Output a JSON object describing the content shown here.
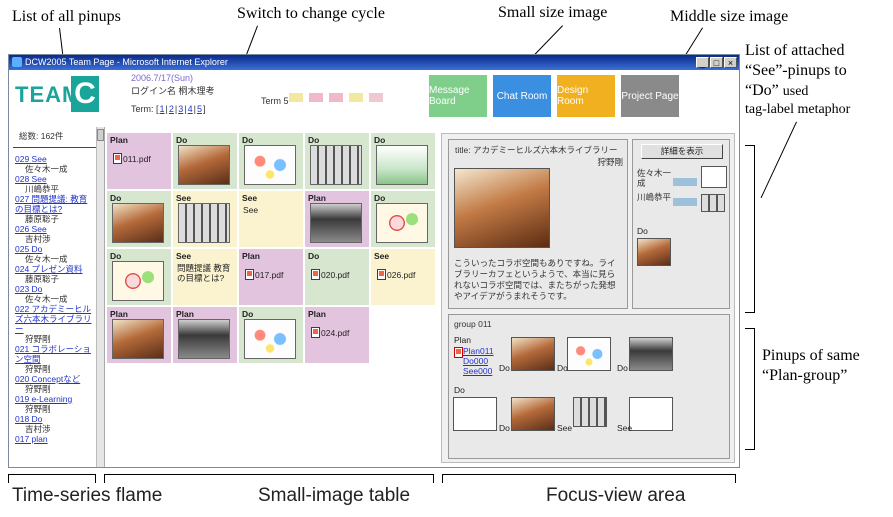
{
  "annotations": {
    "list_of_pinups": "List of all pinups",
    "switch_cycle": "Switch to change cycle",
    "small_image": "Small size image",
    "middle_image": "Middle size image",
    "attached_line1": "List of attached",
    "attached_line2": "“See”-pinups to",
    "attached_line3": "“Do”",
    "attached_line3b": "used",
    "attached_line4": "tag-label metaphor",
    "pinups_line1": "Pinups of same",
    "pinups_line2": "“Plan-group”",
    "time_series": "Time-series flame",
    "small_table": "Small-image table",
    "focus_view": "Focus-view area"
  },
  "window": {
    "title": "DCW2005 Team Page - Microsoft Internet Explorer",
    "controls": [
      "_",
      "□",
      "×"
    ]
  },
  "header": {
    "team": "TEAM",
    "team_letter": "C",
    "date": "2006.7/17(Sun)",
    "login": "ログイン名 桐木理考",
    "term_label": "Term:",
    "terms": [
      "1",
      "2",
      "3",
      "4",
      "5"
    ],
    "current_term": "Term 5",
    "swatch_colors": [
      "#f3e8a0",
      "#f0b8c8",
      "#f0b8c8",
      "#f3e8a0",
      "#f0c8d0"
    ],
    "nav": [
      {
        "label": "Message Board",
        "color": "#7fcf8a"
      },
      {
        "label": "Chat Room",
        "color": "#3a8fe0"
      },
      {
        "label": "Design Room",
        "color": "#f0b020"
      },
      {
        "label": "Project Page",
        "color": "#8a8a8a"
      }
    ]
  },
  "timeline": {
    "total": "総数: 162件",
    "items": [
      {
        "link": "029 See",
        "user": "佐々木一成"
      },
      {
        "link": "028 See",
        "user": "川嶋恭平"
      },
      {
        "link": "027 問題提議: 教育の目標とは?",
        "user": "藤原聡子"
      },
      {
        "link": "026 See",
        "user": "吉村渉"
      },
      {
        "link": "025 Do",
        "user": "佐々木一成"
      },
      {
        "link": "024 プレゼン資料",
        "user": "藤原聡子"
      },
      {
        "link": "023 Do",
        "user": "佐々木一成"
      },
      {
        "link": "022 アカデミーヒルズ六本木ライブラリー",
        "user": "狩野剛"
      },
      {
        "link": "021 コラボレーション空間",
        "user": "狩野剛"
      },
      {
        "link": "020 Conceptなど",
        "user": "狩野剛"
      },
      {
        "link": "019 e-Learning",
        "user": "狩野剛"
      },
      {
        "link": "018 Do",
        "user": "吉村渉"
      },
      {
        "link": "017 plan",
        "user": ""
      }
    ]
  },
  "grid": {
    "cells": [
      {
        "label": "Plan",
        "type": "plan",
        "kind": "pdf",
        "file": "011.pdf"
      },
      {
        "label": "Do",
        "type": "do",
        "kind": "photo",
        "style": "ph-a"
      },
      {
        "label": "Do",
        "type": "do",
        "kind": "photo",
        "style": "ph-c"
      },
      {
        "label": "Do",
        "type": "do",
        "kind": "photo",
        "style": "ph-d"
      },
      {
        "label": "Do",
        "type": "do",
        "kind": "photo",
        "style": "ph-e"
      },
      {
        "label": "Do",
        "type": "do",
        "kind": "photo",
        "style": "ph-a"
      },
      {
        "label": "See",
        "type": "see",
        "kind": "photo",
        "style": "ph-d"
      },
      {
        "label": "See",
        "type": "see",
        "kind": "note",
        "note": "See"
      },
      {
        "label": "Plan",
        "type": "plan",
        "kind": "photo",
        "style": "ph-b"
      },
      {
        "label": "Do",
        "type": "do",
        "kind": "photo",
        "style": "ph-f"
      },
      {
        "label": "Do",
        "type": "do",
        "kind": "photo",
        "style": "ph-f"
      },
      {
        "label": "See",
        "type": "see",
        "kind": "note",
        "note": "問題提議 教育の目標とは?"
      },
      {
        "label": "Plan",
        "type": "plan",
        "kind": "pdf",
        "file": "017.pdf"
      },
      {
        "label": "Do",
        "type": "do",
        "kind": "pdf",
        "file": "020.pdf"
      },
      {
        "label": "See",
        "type": "see",
        "kind": "pdf",
        "file": "026.pdf"
      },
      {
        "label": "Plan",
        "type": "plan",
        "kind": "photo",
        "style": "ph-a"
      },
      {
        "label": "Plan",
        "type": "plan",
        "kind": "photo",
        "style": "ph-b"
      },
      {
        "label": "Do",
        "type": "do",
        "kind": "photo",
        "style": "ph-c"
      },
      {
        "label": "Plan",
        "type": "plan",
        "kind": "pdf",
        "file": "024.pdf"
      },
      {
        "label": "",
        "type": "empty",
        "kind": "empty"
      }
    ]
  },
  "focus": {
    "title": "title: アカデミーヒルズ六本木ライブラリー",
    "author": "狩野剛",
    "text": "こういったコラボ空間もありですね。ライブラリーカフェというようで、本当に見られないコラボ空間では、またちがった発想やアイデアがうまれそうです。",
    "detail_button": "詳細を表示",
    "side_names": [
      "佐々木一成",
      "川嶋恭平"
    ],
    "side_do": "Do",
    "group_title": "group 011",
    "group_plan": "Plan",
    "group_links": [
      "Plan011",
      "Do000",
      "See000"
    ],
    "group_do_label": "Do",
    "group_tags": [
      "Do",
      "Do",
      "Do",
      "Do",
      "See",
      "See"
    ]
  }
}
